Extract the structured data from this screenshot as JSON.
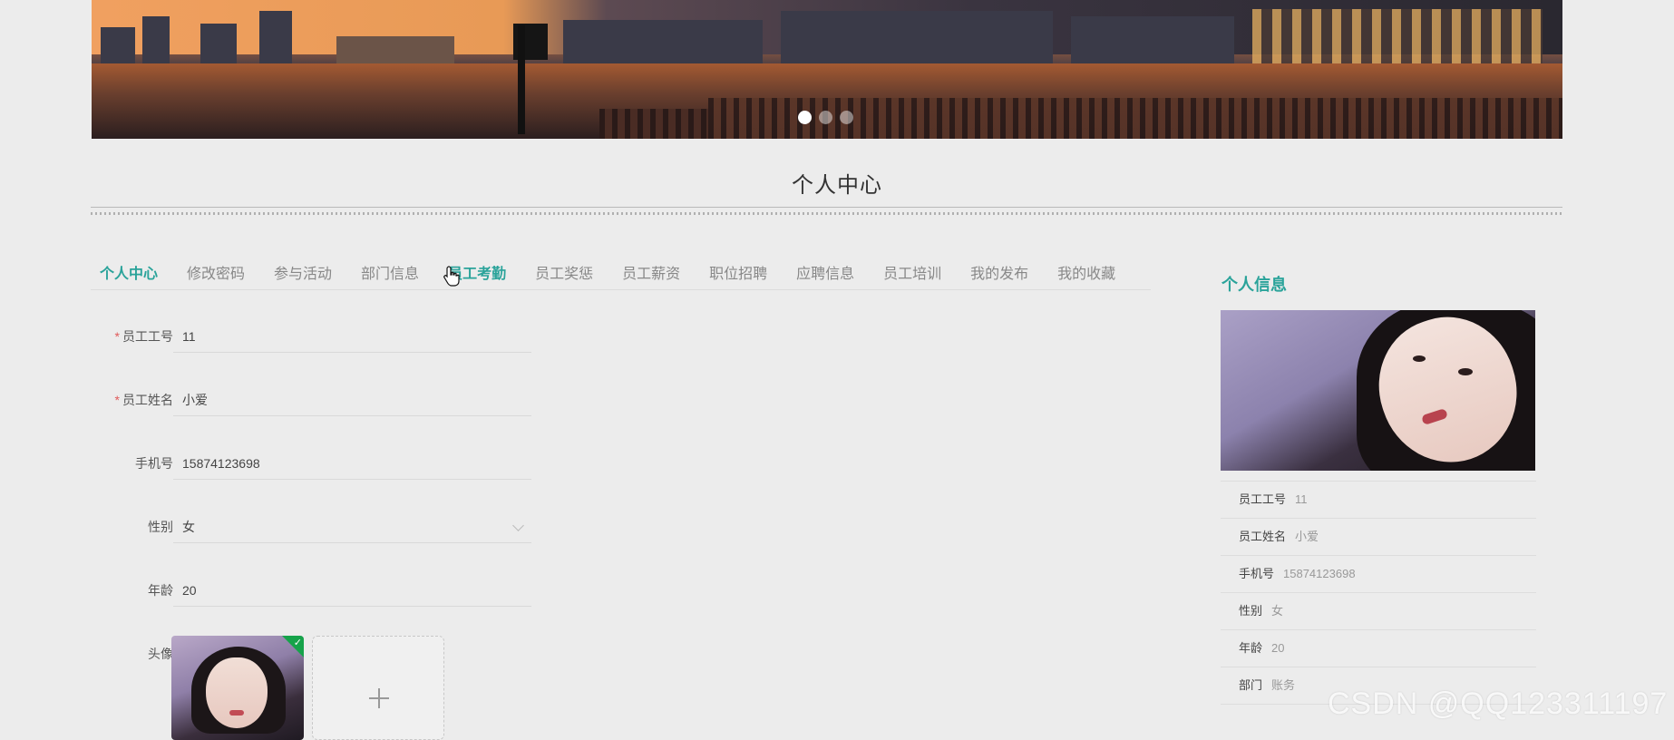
{
  "carousel": {
    "slide_count": 3,
    "active_index": 0
  },
  "page_title": "个人中心",
  "tabs": [
    {
      "label": "个人中心",
      "state": "active"
    },
    {
      "label": "修改密码",
      "state": "normal"
    },
    {
      "label": "参与活动",
      "state": "normal"
    },
    {
      "label": "部门信息",
      "state": "normal"
    },
    {
      "label": "员工考勤",
      "state": "hover"
    },
    {
      "label": "员工奖惩",
      "state": "normal"
    },
    {
      "label": "员工薪资",
      "state": "normal"
    },
    {
      "label": "职位招聘",
      "state": "normal"
    },
    {
      "label": "应聘信息",
      "state": "normal"
    },
    {
      "label": "员工培训",
      "state": "normal"
    },
    {
      "label": "我的发布",
      "state": "normal"
    },
    {
      "label": "我的收藏",
      "state": "normal"
    }
  ],
  "form": {
    "employee_id": {
      "label": "员工工号",
      "value": "11",
      "required": true
    },
    "employee_name": {
      "label": "员工姓名",
      "value": "小爱",
      "required": true
    },
    "phone": {
      "label": "手机号",
      "value": "15874123698"
    },
    "gender": {
      "label": "性别",
      "value": "女"
    },
    "age": {
      "label": "年龄",
      "value": "20"
    },
    "avatar": {
      "label": "头像",
      "plus": "+"
    }
  },
  "required_mark": "*",
  "panel": {
    "title": "个人信息",
    "rows": [
      {
        "k": "员工工号",
        "v": "11"
      },
      {
        "k": "员工姓名",
        "v": "小爱"
      },
      {
        "k": "手机号",
        "v": "15874123698"
      },
      {
        "k": "性别",
        "v": "女"
      },
      {
        "k": "年龄",
        "v": "20"
      },
      {
        "k": "部门",
        "v": "账务"
      }
    ]
  },
  "watermark": "CSDN @QQ123311197",
  "colors": {
    "accent": "#2aa39a",
    "required": "#e05a5a",
    "success": "#16a34a",
    "background": "#ececec"
  }
}
